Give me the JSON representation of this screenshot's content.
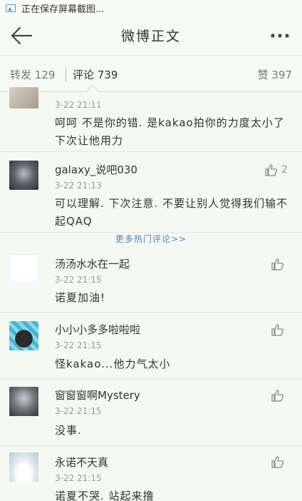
{
  "status_bar": {
    "text": "正在保存屏幕截图..."
  },
  "navbar": {
    "title": "微博正文"
  },
  "stats": {
    "repost_label": "转发",
    "repost_count": "129",
    "comment_label": "评论",
    "comment_count": "739",
    "like_label": "赞",
    "like_count": "397"
  },
  "comments": [
    {
      "name": "",
      "time": "3-22 21:11",
      "text": "呵呵 不是你的错. 是kakao拍你的力度太小了 下次让他用力",
      "likes": ""
    },
    {
      "name": "galaxy_说吧030",
      "time": "3-22 21:13",
      "text": "可以理解. 下次注意. 不要让别人觉得我们输不起QAQ",
      "likes": "2"
    },
    {
      "name": "汤汤水水在一起",
      "time": "3-22 21:15",
      "text": "诺夏加油!",
      "likes": ""
    },
    {
      "name": "小小小多多啦啦啦",
      "time": "3-22 21:15",
      "text": "怪kakao...他力气太小",
      "likes": ""
    },
    {
      "name": "窗窗窗啊Mystery",
      "time": "3-22 21:15",
      "text": "没事.",
      "likes": ""
    },
    {
      "name": "永诺不天真",
      "time": "3-22 21:15",
      "text": "诺夏不哭. 站起来撸",
      "likes": ""
    }
  ],
  "more_hot_comments": "更多热门评论>>",
  "colors": {
    "background": "#f4f9f2",
    "link": "#5a7fbf",
    "muted": "#999999"
  },
  "icons": [
    "image-icon",
    "back-arrow-icon",
    "more-icon",
    "thumbs-up-icon"
  ]
}
